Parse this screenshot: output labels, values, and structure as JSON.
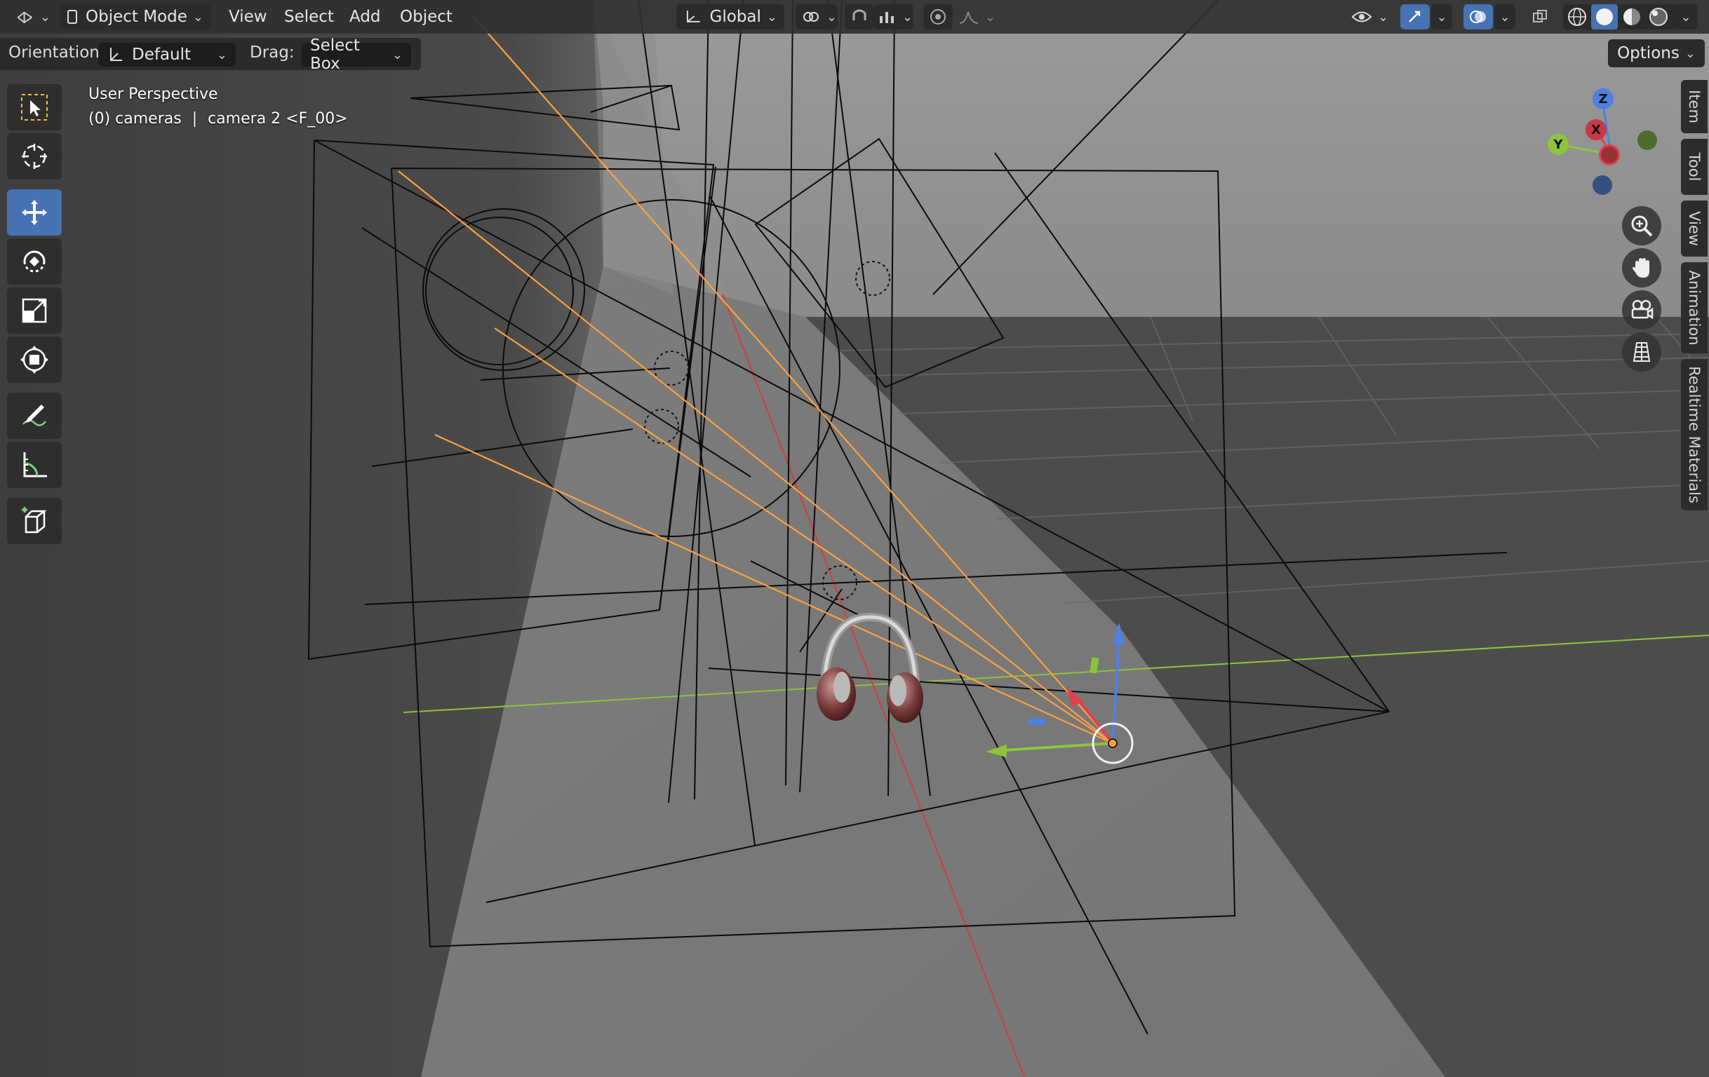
{
  "header": {
    "editor_type_icon": "3d-viewport-icon",
    "mode": "Object Mode",
    "menus": [
      "View",
      "Select",
      "Add",
      "Object"
    ],
    "transform_orientation": "Global",
    "icons": [
      "transform-pivot-icon",
      "snap-icon",
      "snap-increment-icon",
      "proportional-edit-icon",
      "falloff-icon",
      "visibility-icon",
      "gizmo-icon",
      "overlay-icon",
      "xray-icon",
      "wireframe-shading-icon",
      "solid-shading-icon",
      "material-shading-icon",
      "rendered-shading-icon"
    ]
  },
  "tool_settings": {
    "orientation_label": "Orientation:",
    "orientation_value": "Default",
    "drag_label": "Drag:",
    "drag_value": "Select Box",
    "options_label": "Options"
  },
  "toolbar": {
    "tools": [
      {
        "name": "select-box-tool",
        "active": false
      },
      {
        "name": "cursor-tool",
        "active": false
      },
      {
        "name": "move-tool",
        "active": true
      },
      {
        "name": "rotate-tool",
        "active": false
      },
      {
        "name": "scale-tool",
        "active": false
      },
      {
        "name": "transform-tool",
        "active": false
      },
      {
        "name": "annotate-tool",
        "active": false
      },
      {
        "name": "measure-tool",
        "active": false
      },
      {
        "name": "add-cube-tool",
        "active": false
      }
    ]
  },
  "viewport": {
    "view_name": "User Perspective",
    "collection_prefix": "(0) cameras",
    "object_name": "camera 2 <F_00>"
  },
  "sidebar_tabs": [
    "Item",
    "Tool",
    "View",
    "Animation",
    "Realtime Materials"
  ],
  "nav_gizmo": {
    "axes": {
      "z": "Z",
      "y": "Y",
      "x": "X"
    },
    "colors": {
      "x": "#e2404f",
      "y": "#8ec43c",
      "z": "#4f80e2"
    }
  },
  "nav_buttons": [
    "zoom-icon",
    "hand-pan-icon",
    "camera-view-icon",
    "orthographic-grid-icon"
  ],
  "colors": {
    "accent": "#4772b3",
    "selected_object": "#ffa040",
    "x_axis": "#e2404f",
    "y_axis": "#8ec43c",
    "z_axis": "#4f80e2"
  }
}
